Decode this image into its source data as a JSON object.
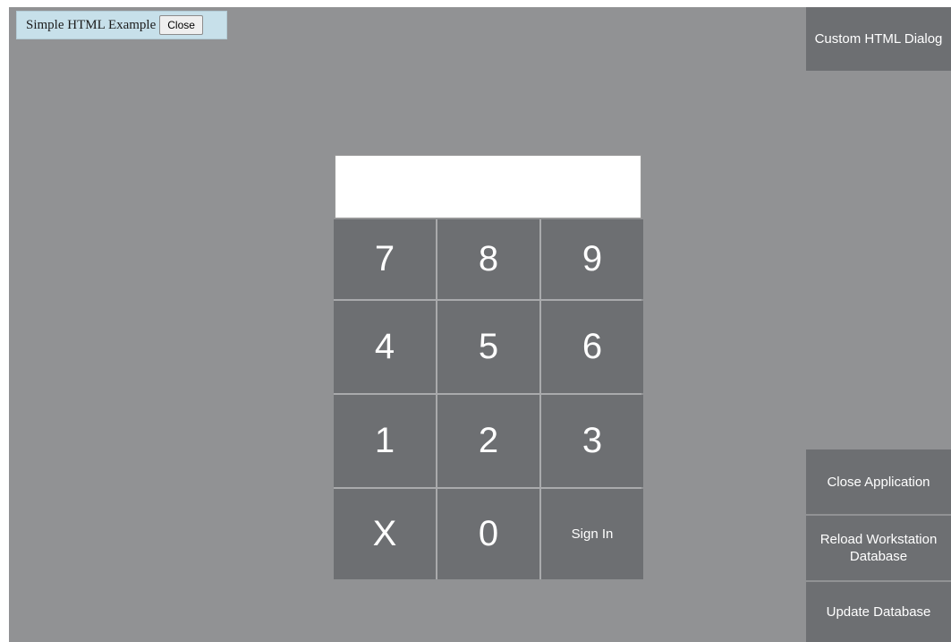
{
  "simple_dialog": {
    "label": "Simple HTML Example",
    "close_label": "Close"
  },
  "side_buttons": {
    "custom_html_dialog": "Custom HTML Dialog",
    "close_application": "Close Application",
    "reload_workstation_database": "Reload Workstation Database",
    "update_database": "Update Database"
  },
  "pin_input": {
    "value": ""
  },
  "keypad": {
    "keys": [
      "7",
      "8",
      "9",
      "4",
      "5",
      "6",
      "1",
      "2",
      "3",
      "X",
      "0",
      "Sign In"
    ]
  },
  "colors": {
    "background": "#919294",
    "button": "#6d6f72",
    "button_text": "#ffffff",
    "dialog_bg": "#c7e0ea"
  }
}
